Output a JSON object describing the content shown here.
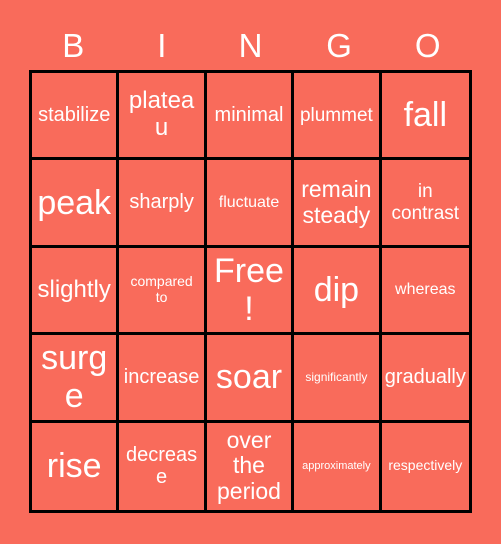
{
  "card": {
    "background_color": "#f96b5b",
    "text_color": "#ffffff",
    "border_color": "#000000",
    "header_letters": [
      "B",
      "I",
      "N",
      "G",
      "O"
    ],
    "rows": [
      [
        {
          "label": "stabilize",
          "size": "sz-md"
        },
        {
          "label": "plateau",
          "size": "sz-lg"
        },
        {
          "label": "minimal",
          "size": "sz-md"
        },
        {
          "label": "plummet",
          "size": "sz-sm"
        },
        {
          "label": "fall",
          "size": "sz-xxl"
        }
      ],
      [
        {
          "label": "peak",
          "size": "sz-xxl"
        },
        {
          "label": "sharply",
          "size": "sz-md"
        },
        {
          "label": "fluctuate",
          "size": "sz-xs"
        },
        {
          "label": "remain\nsteady",
          "size": "sz-ml"
        },
        {
          "label": "in\ncontrast",
          "size": "sz-sm"
        }
      ],
      [
        {
          "label": "slightly",
          "size": "sz-lg"
        },
        {
          "label": "compared\nto",
          "size": "sz-xxs"
        },
        {
          "label": "Free!",
          "size": "sz-xxl"
        },
        {
          "label": "dip",
          "size": "sz-xxl"
        },
        {
          "label": "whereas",
          "size": "sz-xs"
        }
      ],
      [
        {
          "label": "surge",
          "size": "sz-xxl"
        },
        {
          "label": "increase",
          "size": "sz-md"
        },
        {
          "label": "soar",
          "size": "sz-xxl"
        },
        {
          "label": "significantly",
          "size": "sz-tiny"
        },
        {
          "label": "gradually",
          "size": "sz-md"
        }
      ],
      [
        {
          "label": "rise",
          "size": "sz-xxl"
        },
        {
          "label": "decrease",
          "size": "sz-md"
        },
        {
          "label": "over\nthe\nperiod",
          "size": "sz-ml"
        },
        {
          "label": "approximately",
          "size": "sz-micro"
        },
        {
          "label": "respectively",
          "size": "sz-xxs"
        }
      ]
    ]
  }
}
